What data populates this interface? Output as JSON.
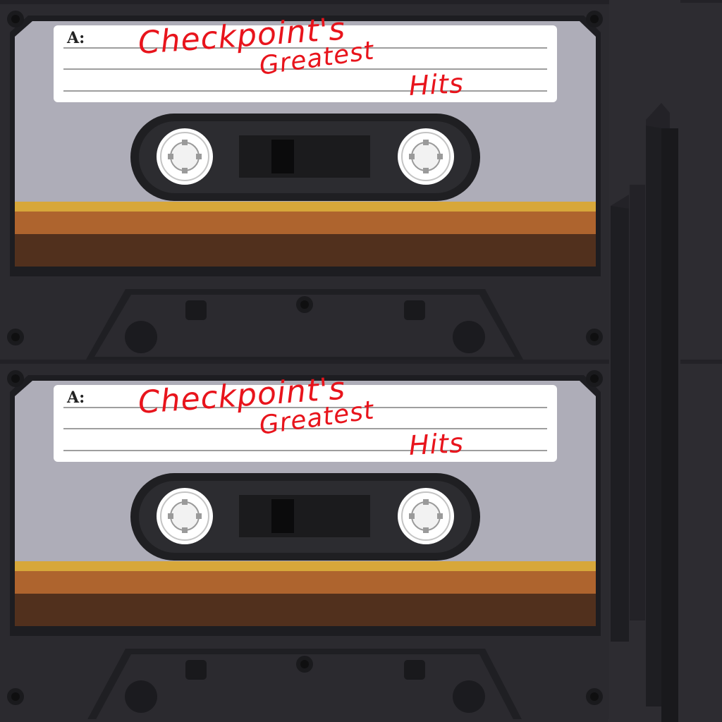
{
  "cassettes": [
    {
      "side_label": "A:",
      "handwriting": {
        "line1": "Checkpoint's",
        "line2": "Greatest",
        "line3": "Hits"
      }
    },
    {
      "side_label": "A:",
      "handwriting": {
        "line1": "Checkpoint's",
        "line2": "Greatest",
        "line3": "Hits"
      }
    }
  ],
  "colors": {
    "shell": "#2b2a2f",
    "face": "#aeadb8",
    "label": "#ffffff",
    "ink": "#e8141c",
    "stripe_gold": "#d7a73a",
    "stripe_orange": "#ae642e",
    "stripe_brown": "#51301d"
  },
  "icons": {
    "reel": "reel-icon",
    "screw": "screw-icon"
  }
}
